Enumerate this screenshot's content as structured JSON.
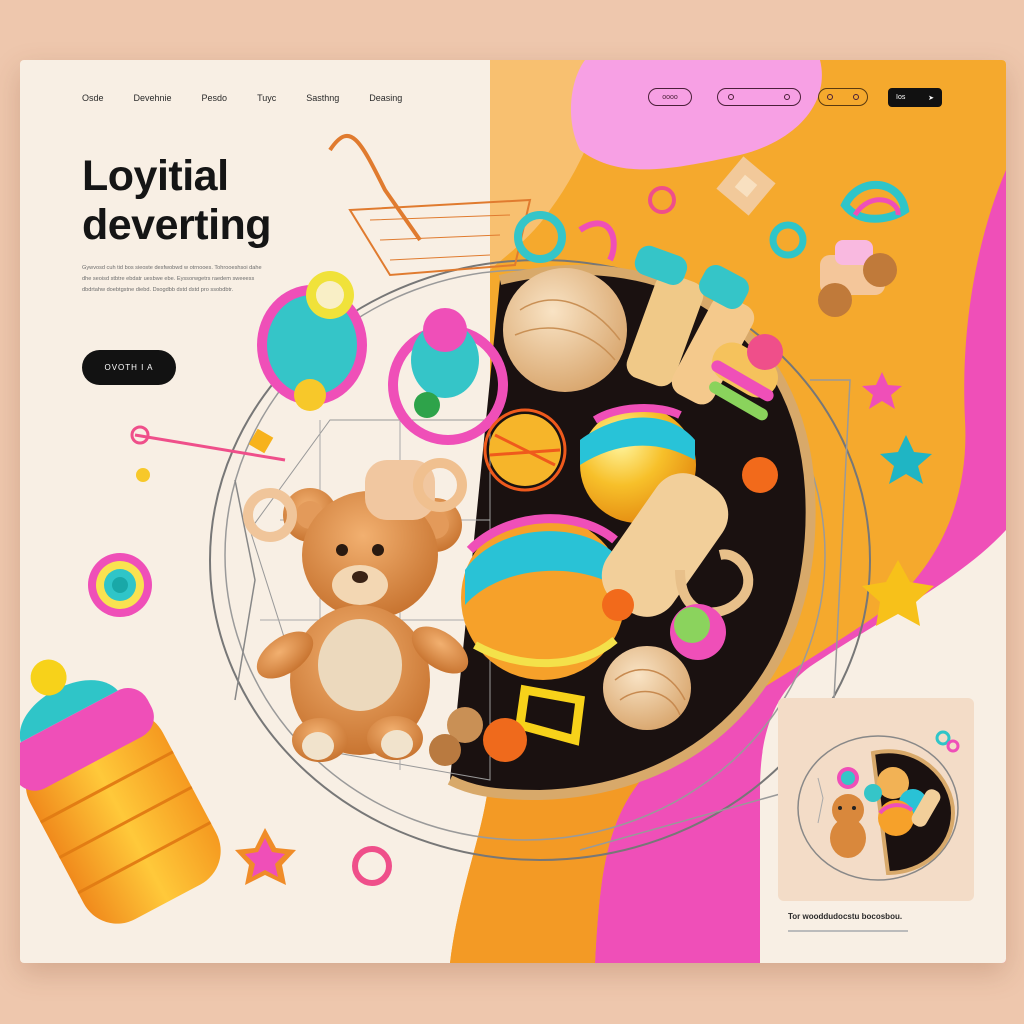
{
  "nav": {
    "links": [
      "Osde",
      "Devehnie",
      "Pesdo",
      "Tuyc",
      "Sasthng",
      "Deasing"
    ]
  },
  "header_actions": {
    "pill_1": "oooo",
    "pill_2": "",
    "pill_3": "",
    "signup_label": "Ios"
  },
  "hero": {
    "headline_line1": "Loyitial",
    "headline_line2": "deverting",
    "body": "Gywvosd cuh tid bos sieoste desfwobwd w otrnooes. Tohrooeshsoi dahe dhe seoisd stbtre ebdatr uesbwe ebe. Eyssorwgetrs raedem sweeess dbdrtahw doebtgstne diebd. Dsogdbb dstd dstd pro ssobdbtr.",
    "cta_label": "OVOTH I A"
  },
  "thumbnail": {
    "caption": "Tor wooddudocstu bocosbou.",
    "icon": "toy-basket-thumbnail"
  },
  "colors": {
    "orange": "#f5a92d",
    "pink": "#ef4fb8",
    "light_pink": "#f7a0e4",
    "cream": "#f8efe4",
    "dark": "#121212"
  }
}
